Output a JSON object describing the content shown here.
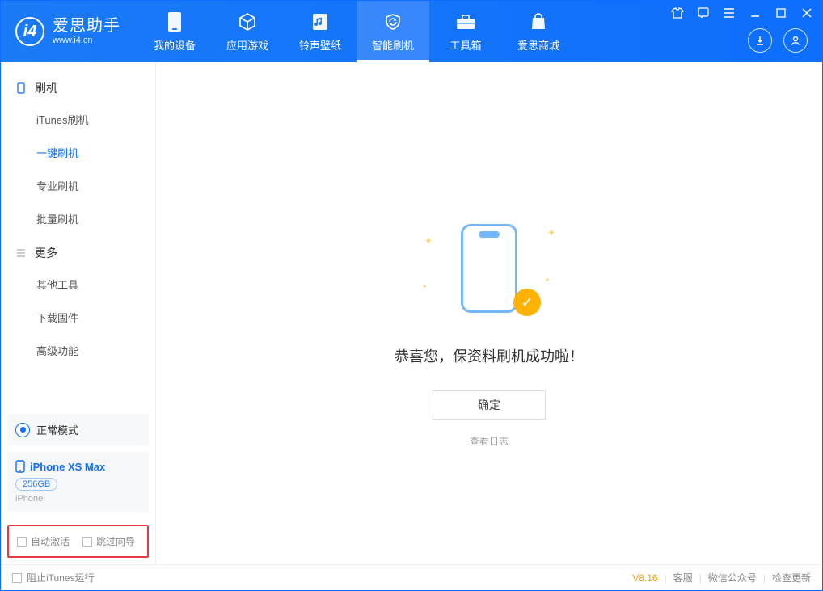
{
  "app": {
    "name_cn": "爱思助手",
    "url": "www.i4.cn"
  },
  "tabs": {
    "device": "我的设备",
    "apps": "应用游戏",
    "ringtones": "铃声壁纸",
    "flash": "智能刷机",
    "tools": "工具箱",
    "store": "爱思商城"
  },
  "sidebar": {
    "group_flash": "刷机",
    "items_flash": {
      "itunes": "iTunes刷机",
      "onekey": "一键刷机",
      "pro": "专业刷机",
      "batch": "批量刷机"
    },
    "group_more": "更多",
    "items_more": {
      "other": "其他工具",
      "firmware": "下载固件",
      "advanced": "高级功能"
    },
    "mode": "正常模式",
    "device": {
      "name": "iPhone XS Max",
      "capacity": "256GB",
      "type": "iPhone"
    },
    "options": {
      "auto_activate": "自动激活",
      "skip_guide": "跳过向导"
    }
  },
  "content": {
    "success_msg": "恭喜您，保资料刷机成功啦！",
    "ok_btn": "确定",
    "view_log": "查看日志"
  },
  "statusbar": {
    "block_itunes": "阻止iTunes运行",
    "version": "V8.16",
    "support": "客服",
    "wechat": "微信公众号",
    "check_update": "检查更新"
  }
}
